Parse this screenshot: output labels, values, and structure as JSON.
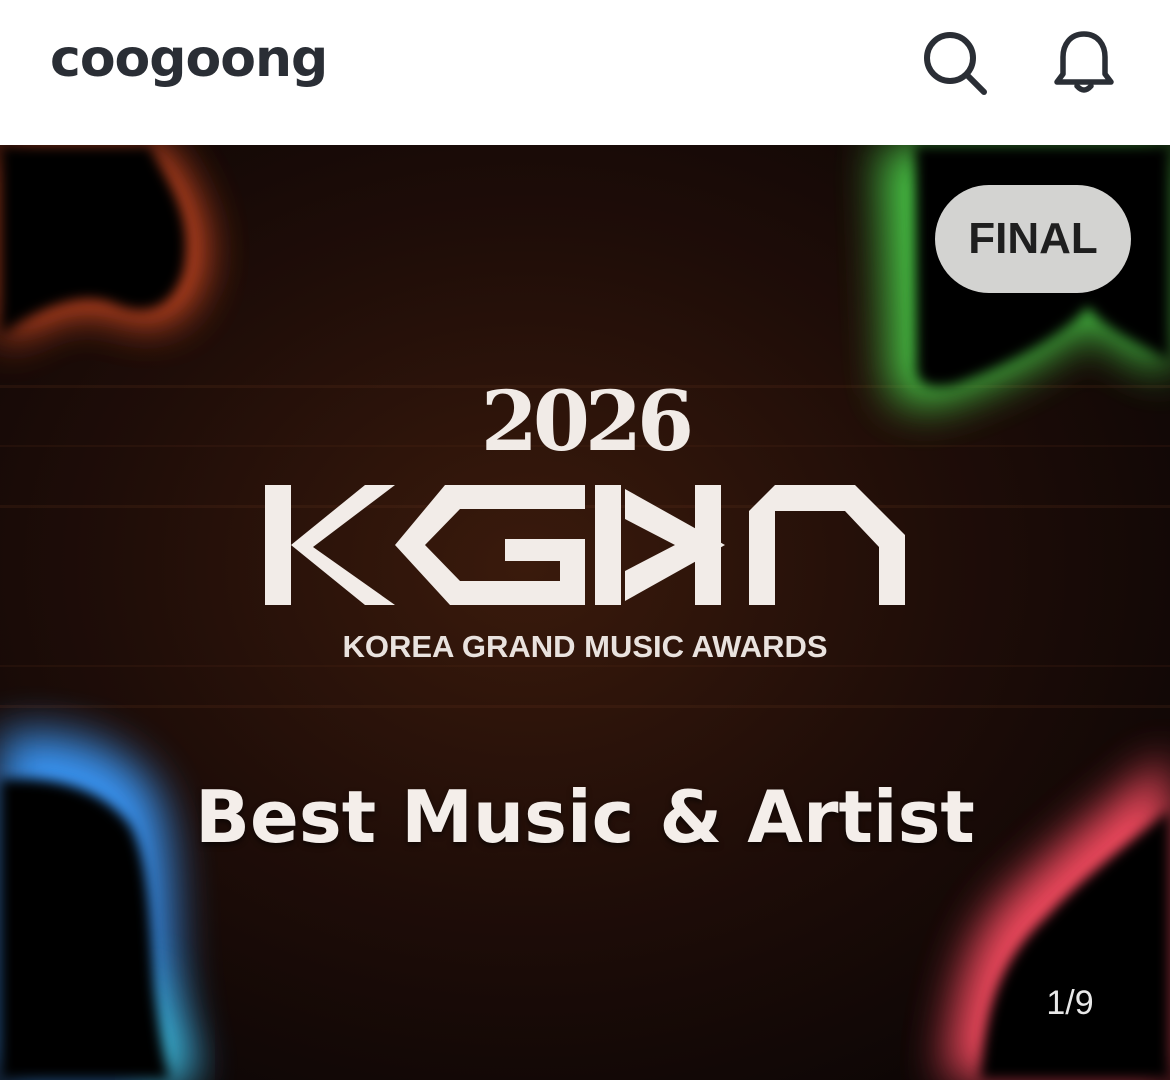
{
  "header": {
    "logo_text": "coogoong",
    "search_icon": "search-icon",
    "bell_icon": "bell-icon"
  },
  "banner": {
    "badge": "FINAL",
    "year": "2026",
    "logo_text": "KGMA",
    "subtitle": "KOREA GRAND MUSIC AWARDS",
    "headline": "Best Music & Artist",
    "page_indicator": "1/9",
    "colors": {
      "background": "#140907",
      "orange_glow": "#ff6a3d",
      "green_glow": "#5cd65a",
      "blue_glow": "#4da3ff",
      "pink_glow": "#ff5a6e",
      "badge_bg": "#d3d3d1"
    }
  }
}
